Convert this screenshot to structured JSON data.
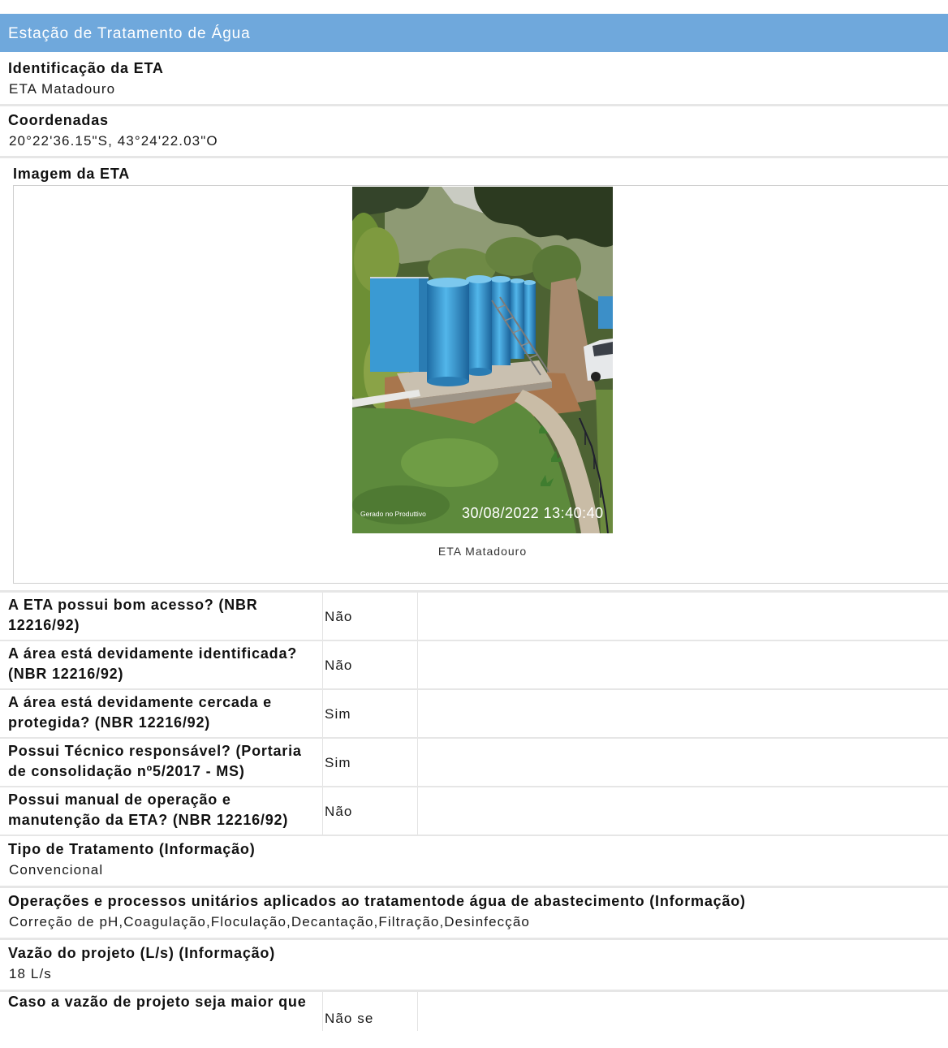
{
  "header": {
    "title": "Estação de Tratamento de Água"
  },
  "identification": {
    "label": "Identificação da ETA",
    "value": "ETA Matadouro"
  },
  "coordinates": {
    "label": "Coordenadas",
    "value": "20°22'36.15\"S, 43°24'22.03\"O"
  },
  "image_section": {
    "label": "Imagem da ETA",
    "caption": "ETA Matadouro",
    "photo_overlay": {
      "source": "Gerado no Produttivo",
      "timestamp": "30/08/2022 13:40:40"
    }
  },
  "checklist": [
    {
      "question": "A ETA possui bom acesso? (NBR 12216/92)",
      "answer": "Não"
    },
    {
      "question": "A área está devidamente identificada? (NBR 12216/92)",
      "answer": "Não"
    },
    {
      "question": "A área está devidamente cercada e protegida? (NBR 12216/92)",
      "answer": "Sim"
    },
    {
      "question": "Possui Técnico responsável? (Portaria de consolidação nº5/2017 - MS)",
      "answer": "Sim"
    },
    {
      "question": "Possui manual de operação e manutenção da ETA? (NBR 12216/92)",
      "answer": "Não"
    }
  ],
  "treatment_type": {
    "label": "Tipo de Tratamento (Informação)",
    "value": "Convencional"
  },
  "unit_operations": {
    "label": "Operações e processos unitários aplicados ao tratamentode água de abastecimento (Informação)",
    "value": "Correção de pH,Coagulação,Floculação,Decantação,Filtração,Desinfecção"
  },
  "design_flow": {
    "label": "Vazão do projeto (L/s) (Informação)",
    "value": "18 L/s"
  },
  "flow_condition": {
    "question": "Caso a vazão de projeto seja maior que",
    "answer": "Não se"
  },
  "colors": {
    "header_background": "#6fa8dc",
    "header_text": "#ffffff",
    "separator": "#e6e6e6"
  }
}
